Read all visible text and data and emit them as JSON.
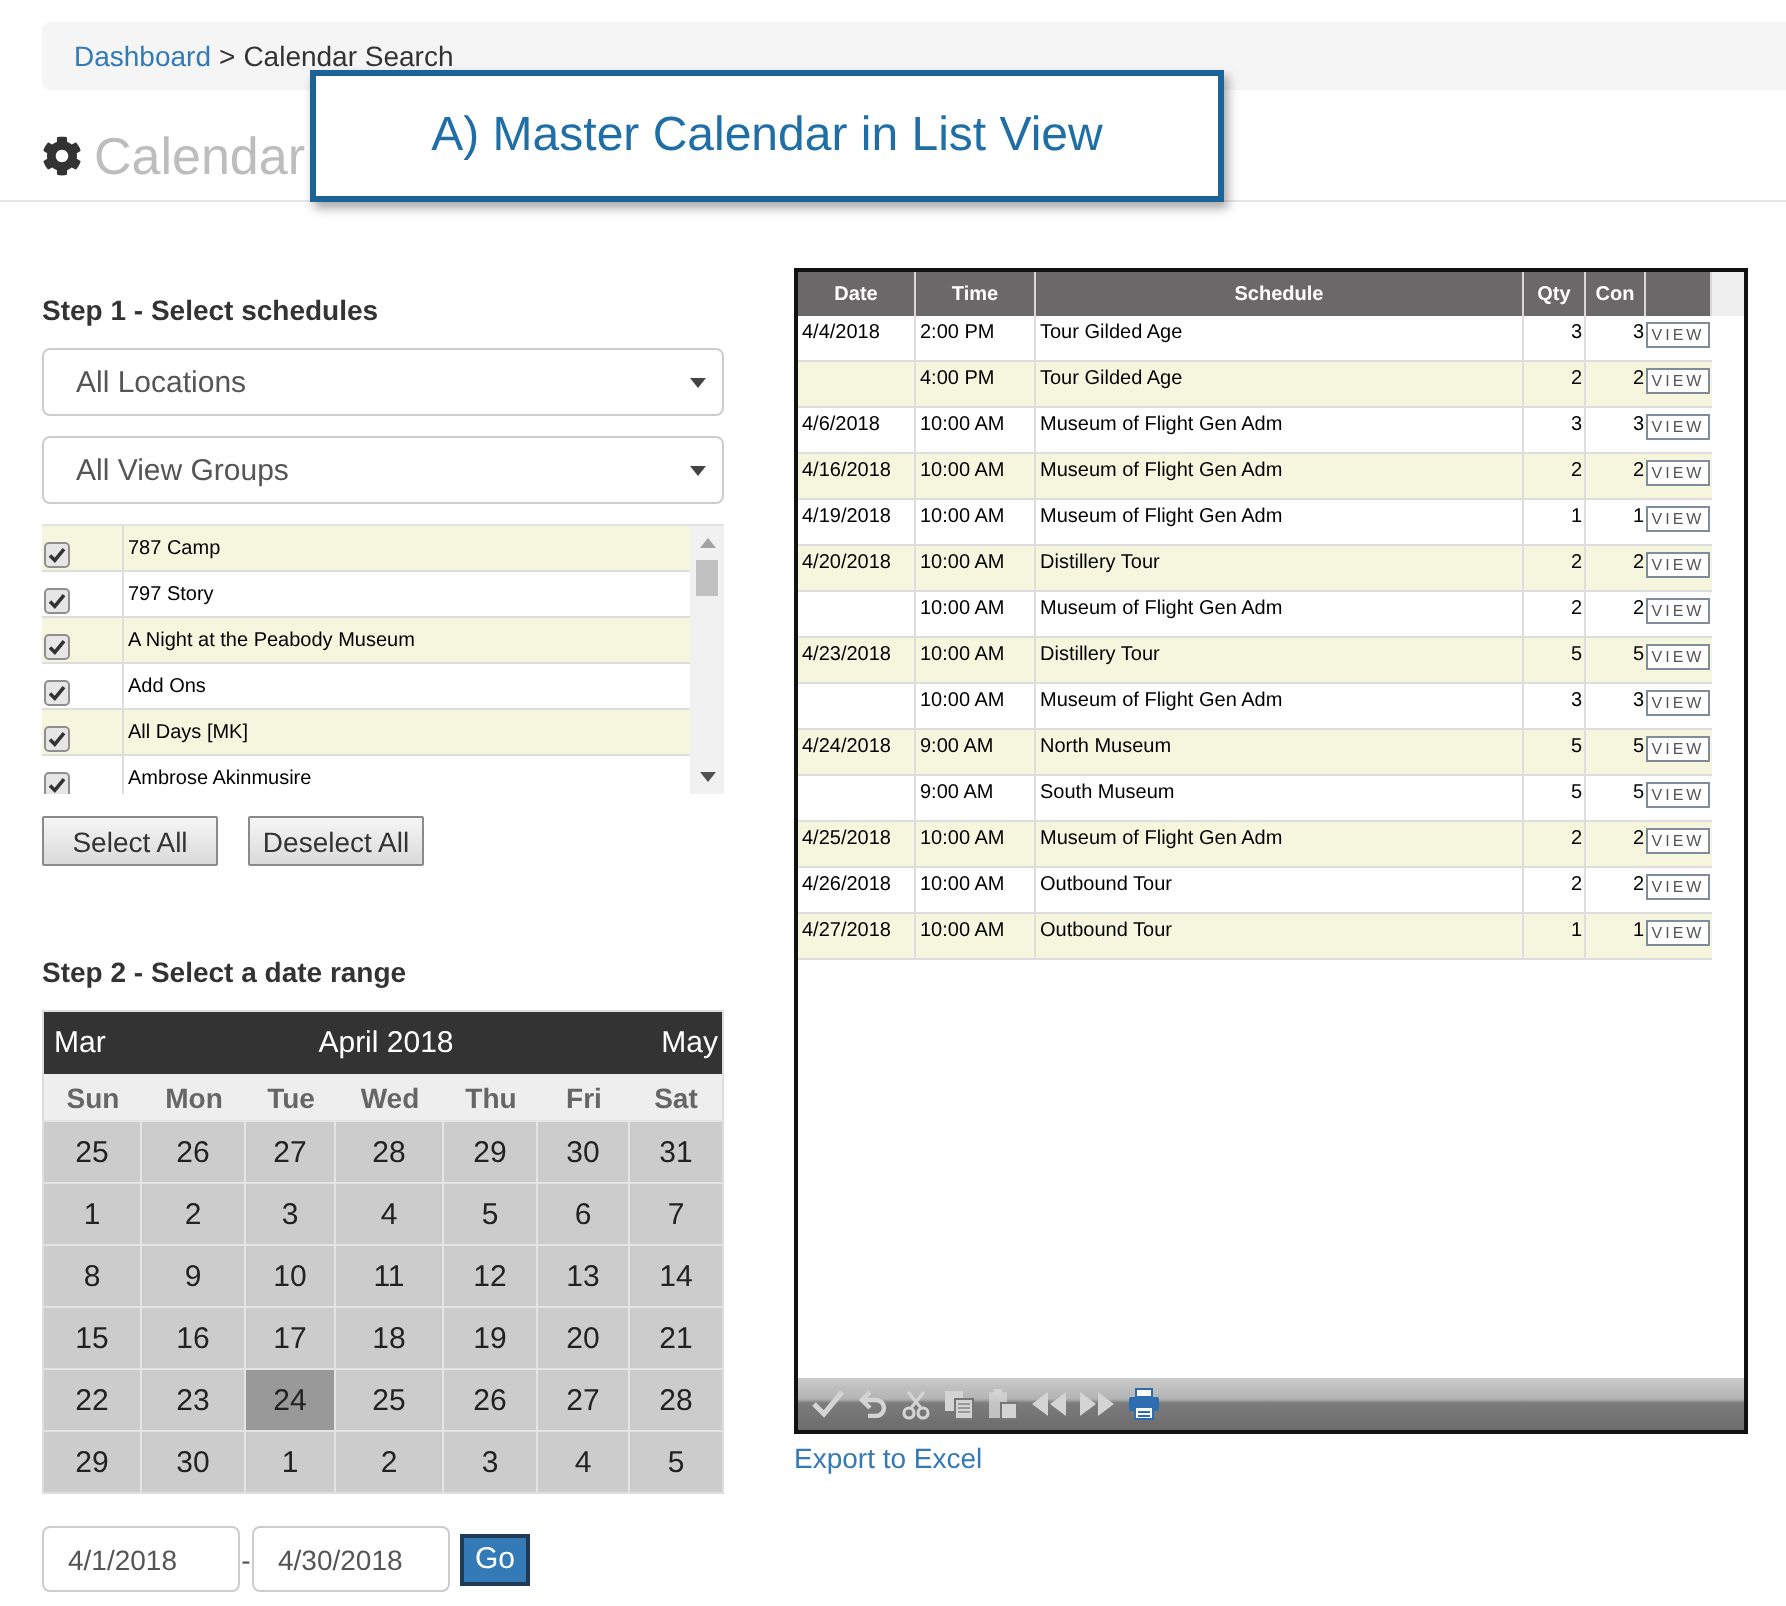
{
  "breadcrumb": {
    "link": "Dashboard",
    "separator": ">",
    "current": "Calendar Search"
  },
  "callout": {
    "text": "A) Master Calendar in List View"
  },
  "page_title": "Calendar",
  "step1": {
    "heading": "Step 1 - Select schedules",
    "selects": [
      {
        "value": "All Locations"
      },
      {
        "value": "All View Groups"
      }
    ],
    "schedules": [
      {
        "name": "787 Camp",
        "checked": true
      },
      {
        "name": "797 Story",
        "checked": true
      },
      {
        "name": "A Night at the Peabody Museum",
        "checked": true
      },
      {
        "name": "Add Ons",
        "checked": true
      },
      {
        "name": "All Days [MK]",
        "checked": true
      },
      {
        "name": "Ambrose Akinmusire",
        "checked": true
      }
    ],
    "buttons": [
      "Select All",
      "Deselect All"
    ]
  },
  "step2": {
    "heading": "Step 2 - Select a date range",
    "calendar": {
      "prev": "Mar",
      "title": "April 2018",
      "next": "May",
      "weekdays": [
        "Sun",
        "Mon",
        "Tue",
        "Wed",
        "Thu",
        "Fri",
        "Sat"
      ],
      "weeks": [
        {
          "days": [
            {
              "day": "25",
              "selected": false
            },
            {
              "day": "26",
              "selected": false
            },
            {
              "day": "27",
              "selected": false
            },
            {
              "day": "28",
              "selected": false
            },
            {
              "day": "29",
              "selected": false
            },
            {
              "day": "30",
              "selected": false
            },
            {
              "day": "31",
              "selected": false
            }
          ]
        },
        {
          "days": [
            {
              "day": "1",
              "selected": false
            },
            {
              "day": "2",
              "selected": false
            },
            {
              "day": "3",
              "selected": false
            },
            {
              "day": "4",
              "selected": false
            },
            {
              "day": "5",
              "selected": false
            },
            {
              "day": "6",
              "selected": false
            },
            {
              "day": "7",
              "selected": false
            }
          ]
        },
        {
          "days": [
            {
              "day": "8",
              "selected": false
            },
            {
              "day": "9",
              "selected": false
            },
            {
              "day": "10",
              "selected": false
            },
            {
              "day": "11",
              "selected": false
            },
            {
              "day": "12",
              "selected": false
            },
            {
              "day": "13",
              "selected": false
            },
            {
              "day": "14",
              "selected": false
            }
          ]
        },
        {
          "days": [
            {
              "day": "15",
              "selected": false
            },
            {
              "day": "16",
              "selected": false
            },
            {
              "day": "17",
              "selected": false
            },
            {
              "day": "18",
              "selected": false
            },
            {
              "day": "19",
              "selected": false
            },
            {
              "day": "20",
              "selected": false
            },
            {
              "day": "21",
              "selected": false
            }
          ]
        },
        {
          "days": [
            {
              "day": "22",
              "selected": false
            },
            {
              "day": "23",
              "selected": false
            },
            {
              "day": "24",
              "selected": true
            },
            {
              "day": "25",
              "selected": false
            },
            {
              "day": "26",
              "selected": false
            },
            {
              "day": "27",
              "selected": false
            },
            {
              "day": "28",
              "selected": false
            }
          ]
        },
        {
          "days": [
            {
              "day": "29",
              "selected": false
            },
            {
              "day": "30",
              "selected": false
            },
            {
              "day": "1",
              "selected": false
            },
            {
              "day": "2",
              "selected": false
            },
            {
              "day": "3",
              "selected": false
            },
            {
              "day": "4",
              "selected": false
            },
            {
              "day": "5",
              "selected": false
            }
          ]
        }
      ]
    },
    "start_date": "4/1/2018",
    "separator": "-",
    "end_date": "4/30/2018",
    "go_button": "Go"
  },
  "grid": {
    "columns": [
      "Date",
      "Time",
      "Schedule",
      "Qty",
      "Con"
    ],
    "rows": [
      {
        "date": "4/4/2018",
        "time": "2:00 PM",
        "schedule": "Tour Gilded Age",
        "qty": "3",
        "con": "3",
        "action": "VIEW"
      },
      {
        "time": "4:00 PM",
        "schedule": "Tour Gilded Age",
        "qty": "2",
        "con": "2",
        "action": "VIEW"
      },
      {
        "date": "4/6/2018",
        "time": "10:00 AM",
        "schedule": "Museum of Flight Gen Adm",
        "qty": "3",
        "con": "3",
        "action": "VIEW"
      },
      {
        "date": "4/16/2018",
        "time": "10:00 AM",
        "schedule": "Museum of Flight Gen Adm",
        "qty": "2",
        "con": "2",
        "action": "VIEW"
      },
      {
        "date": "4/19/2018",
        "time": "10:00 AM",
        "schedule": "Museum of Flight Gen Adm",
        "qty": "1",
        "con": "1",
        "action": "VIEW"
      },
      {
        "date": "4/20/2018",
        "time": "10:00 AM",
        "schedule": "Distillery Tour",
        "qty": "2",
        "con": "2",
        "action": "VIEW"
      },
      {
        "time": "10:00 AM",
        "schedule": "Museum of Flight Gen Adm",
        "qty": "2",
        "con": "2",
        "action": "VIEW"
      },
      {
        "date": "4/23/2018",
        "time": "10:00 AM",
        "schedule": "Distillery Tour",
        "qty": "5",
        "con": "5",
        "action": "VIEW"
      },
      {
        "time": "10:00 AM",
        "schedule": "Museum of Flight Gen Adm",
        "qty": "3",
        "con": "3",
        "action": "VIEW"
      },
      {
        "date": "4/24/2018",
        "time": "9:00 AM",
        "schedule": "North Museum",
        "qty": "5",
        "con": "5",
        "action": "VIEW"
      },
      {
        "time": "9:00 AM",
        "schedule": "South Museum",
        "qty": "5",
        "con": "5",
        "action": "VIEW"
      },
      {
        "date": "4/25/2018",
        "time": "10:00 AM",
        "schedule": "Museum of Flight Gen Adm",
        "qty": "2",
        "con": "2",
        "action": "VIEW"
      },
      {
        "date": "4/26/2018",
        "time": "10:00 AM",
        "schedule": "Outbound Tour",
        "qty": "2",
        "con": "2",
        "action": "VIEW"
      },
      {
        "date": "4/27/2018",
        "time": "10:00 AM",
        "schedule": "Outbound Tour",
        "qty": "1",
        "con": "1",
        "action": "VIEW"
      }
    ],
    "toolbar": [
      {
        "disabled": true
      },
      {
        "disabled": true
      },
      {
        "disabled": true
      },
      {
        "disabled": true
      },
      {
        "disabled": true
      },
      {
        "disabled": true
      },
      {
        "disabled": true
      },
      {
        "disabled": false
      }
    ]
  },
  "export_link": "Export to Excel"
}
